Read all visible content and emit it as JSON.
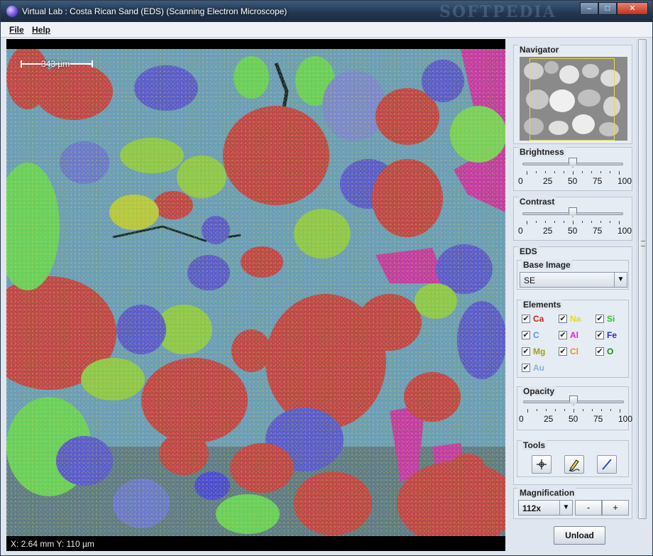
{
  "window": {
    "title": "Virtual Lab : Costa Rican Sand (EDS) (Scanning Electron Microscope)",
    "watermark": "SOFTPEDIA",
    "controls": {
      "minimize": "–",
      "maximize": "□",
      "close": "✕"
    }
  },
  "menu": {
    "file": "File",
    "help": "Help"
  },
  "viewer": {
    "scale_label": "343 µm",
    "coords": "X: 2.64 mm  Y: 110 µm"
  },
  "navigator": {
    "title": "Navigator"
  },
  "brightness": {
    "title": "Brightness",
    "value": 50,
    "ticks": [
      "0",
      "25",
      "50",
      "75",
      "100"
    ]
  },
  "contrast": {
    "title": "Contrast",
    "value": 50,
    "ticks": [
      "0",
      "25",
      "50",
      "75",
      "100"
    ]
  },
  "eds": {
    "title": "EDS",
    "base_image": {
      "title": "Base Image",
      "value": "SE"
    },
    "elements_title": "Elements",
    "elements": [
      {
        "symbol": "Ca",
        "checked": true,
        "color": "#d42020"
      },
      {
        "symbol": "Na",
        "checked": true,
        "color": "#e8e000"
      },
      {
        "symbol": "Si",
        "checked": true,
        "color": "#22cc22"
      },
      {
        "symbol": "C",
        "checked": true,
        "color": "#4a9ae8"
      },
      {
        "symbol": "Al",
        "checked": true,
        "color": "#e020d0"
      },
      {
        "symbol": "Fe",
        "checked": true,
        "color": "#2a2ad8"
      },
      {
        "symbol": "Mg",
        "checked": true,
        "color": "#a0a020"
      },
      {
        "symbol": "Cl",
        "checked": true,
        "color": "#e89020"
      },
      {
        "symbol": "O",
        "checked": true,
        "color": "#1a8a1a"
      },
      {
        "symbol": "Au",
        "checked": true,
        "color": "#8ab0d8"
      }
    ],
    "check_glyph": "✔",
    "opacity": {
      "title": "Opacity",
      "value": 50,
      "ticks": [
        "0",
        "25",
        "50",
        "75",
        "100"
      ]
    },
    "tools": {
      "title": "Tools",
      "icons": [
        "crosshair-icon",
        "pencil-icon",
        "line-icon"
      ]
    }
  },
  "magnification": {
    "title": "Magnification",
    "value": "112x",
    "minus": "-",
    "plus": "+"
  },
  "actions": {
    "unload": "Unload"
  }
}
